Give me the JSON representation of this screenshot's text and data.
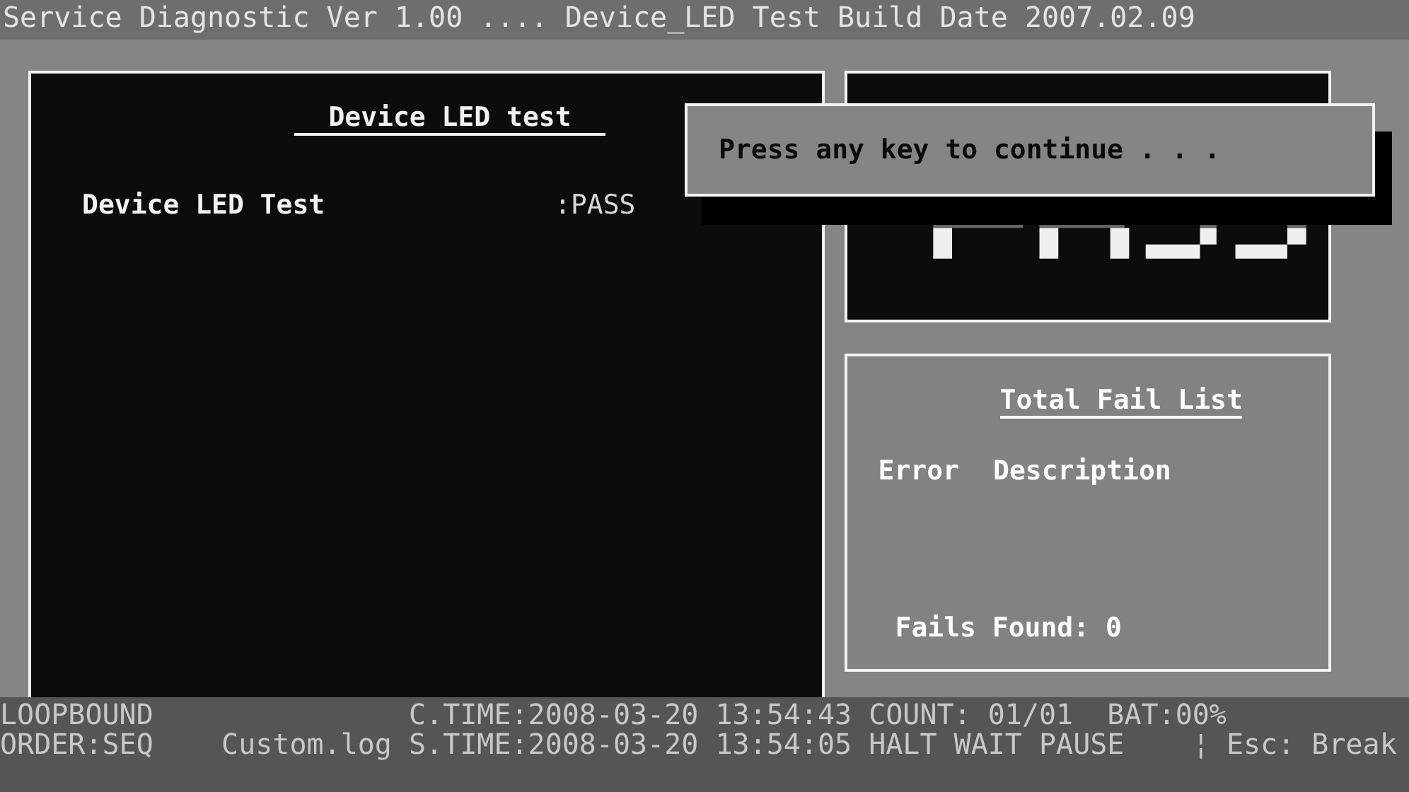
{
  "title_bar": "Service Diagnostic Ver 1.00 .... Device_LED Test Build Date 2007.02.09",
  "test_panel": {
    "title": "Device LED test",
    "results": [
      {
        "name": "Device LED Test",
        "result": ":PASS"
      }
    ]
  },
  "fail_list": {
    "title": "Total Fail List",
    "columns": [
      "Error",
      "Description"
    ],
    "summary": "Fails Found: 0"
  },
  "popup": "Press any key to continue . . .",
  "status_bar": [
    "LOOPBOUND               C.TIME:2008-03-20 13:54:43 COUNT: 01/01  BAT:00%",
    "ORDER:SEQ    Custom.log S.TIME:2008-03-20 13:54:05 HALT WAIT PAUSE    ¦ Esc: Break"
  ]
}
